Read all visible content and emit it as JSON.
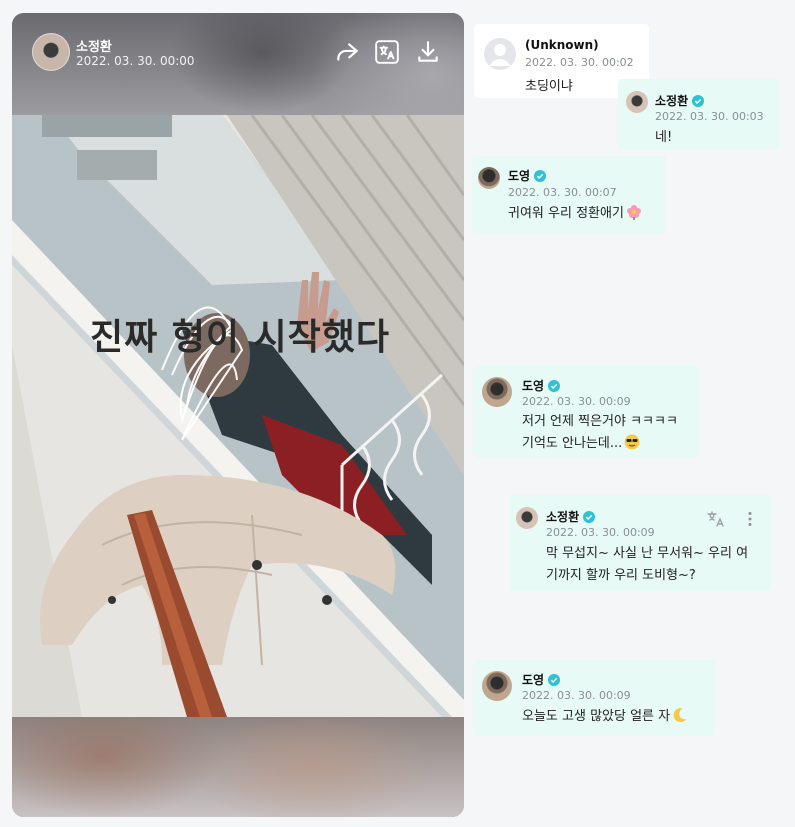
{
  "story": {
    "author": "소정환",
    "timestamp": "2022. 03. 30. 00:00",
    "overlay_text": "진짜 형이 시작했다",
    "icons": [
      "share-icon",
      "translate-icon",
      "download-icon"
    ]
  },
  "messages": [
    {
      "name": "(Unknown)",
      "time": "2022. 03. 30. 00:02",
      "text": "초딩이냐",
      "avatar": "default-avatar-icon",
      "verified": false
    },
    {
      "name": "소정환",
      "time": "2022. 03. 30. 00:03",
      "text": "네!",
      "verified": true
    },
    {
      "name": "도영",
      "time": "2022. 03. 30. 00:07",
      "text": "귀여워 우리 정환애기",
      "emoji": "flower-emoji",
      "verified": true
    },
    {
      "name": "도영",
      "time": "2022. 03. 30. 00:09",
      "text": "저거 언제 찍은거야 ㅋㅋㅋㅋ\n기억도 안나는데...",
      "emoji": "sunglasses-emoji",
      "verified": true
    },
    {
      "name": "소정환",
      "time": "2022. 03. 30. 00:09",
      "text": "막 무섭지~ 사실 난 무서워~ 우리 여\n기까지 할까 우리 도비형~?",
      "verified": true,
      "actions": [
        "translate-icon",
        "more-icon"
      ]
    },
    {
      "name": "도영",
      "time": "2022. 03. 30. 00:09",
      "text": "오늘도 고생 많았당 얼른 자",
      "emoji": "crescent-moon-emoji",
      "verified": true
    }
  ],
  "colors": {
    "bubble": "#e8faf5",
    "verified": "#2fc1d6",
    "page_bg": "#f5f6f8"
  }
}
